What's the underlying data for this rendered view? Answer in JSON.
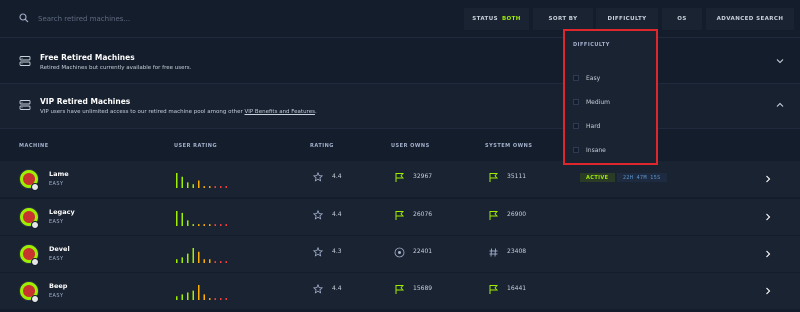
{
  "search": {
    "placeholder": "Search retired machines..."
  },
  "filters": {
    "status_label": "STATUS",
    "status_value": "BOTH",
    "sort_label": "SORT BY",
    "difficulty_label": "DIFFICULTY",
    "os_label": "OS",
    "advanced_label": "ADVANCED SEARCH"
  },
  "sections": {
    "free": {
      "title": "Free Retired Machines",
      "subtitle": "Retired Machines but currently available for free users."
    },
    "vip": {
      "title": "VIP Retired Machines",
      "subtitle_pre": "VIP users have unlimited access to our retired machine pool among other ",
      "subtitle_link": "VIP Benefits and Features",
      "subtitle_post": "."
    }
  },
  "table": {
    "headers": {
      "machine": "MACHINE",
      "user_rating": "USER RATING",
      "rating": "RATING",
      "user_owns": "USER OWNS",
      "system_owns": "SYSTEM OWNS"
    },
    "rows": [
      {
        "name": "Lame",
        "difficulty": "EASY",
        "rating": "4.4",
        "user_owns": "32967",
        "system_owns": "35111",
        "status": "ACTIVE",
        "time": "22H 47M 15S",
        "bars": [
          8,
          6,
          3,
          2,
          4,
          1,
          1,
          1,
          1,
          1
        ]
      },
      {
        "name": "Legacy",
        "difficulty": "EASY",
        "rating": "4.4",
        "user_owns": "26076",
        "system_owns": "26900",
        "bars": [
          8,
          7,
          3,
          1,
          1,
          1,
          1,
          1,
          1,
          1
        ]
      },
      {
        "name": "Devel",
        "difficulty": "EASY",
        "rating": "4.3",
        "user_owns": "22401",
        "system_owns": "23408",
        "bars": [
          2,
          3,
          5,
          8,
          6,
          2,
          2,
          1,
          1,
          1
        ]
      },
      {
        "name": "Beep",
        "difficulty": "EASY",
        "rating": "4.4",
        "user_owns": "15689",
        "system_owns": "16441",
        "bars": [
          2,
          3,
          4,
          5,
          8,
          3,
          1,
          1,
          1,
          1
        ]
      }
    ]
  },
  "dropdown": {
    "title": "DIFFICULTY",
    "options": [
      "Easy",
      "Medium",
      "Hard",
      "Insane"
    ]
  },
  "colors": {
    "background": "#141d2b",
    "panel": "#1a2332",
    "accent_green": "#9fef00",
    "highlight_red": "#e0262d"
  }
}
